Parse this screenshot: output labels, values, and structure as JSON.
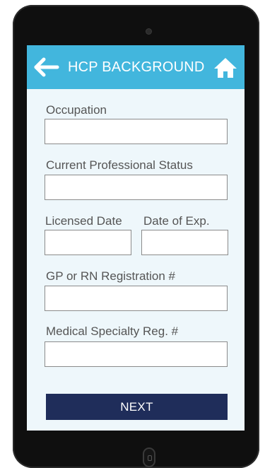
{
  "appbar": {
    "title": "HCP BACKGROUND",
    "back_icon": "arrow-left-icon",
    "home_icon": "home-icon",
    "color": "#42b6dd"
  },
  "form": {
    "occupation": {
      "label": "Occupation",
      "value": ""
    },
    "professional_status": {
      "label": "Current Professional Status",
      "value": ""
    },
    "licensed_date": {
      "label": "Licensed Date",
      "value": ""
    },
    "expiry_date": {
      "label": "Date of Exp.",
      "value": ""
    },
    "registration": {
      "label": "GP or RN Registration #",
      "value": ""
    },
    "specialty_reg": {
      "label": "Medical Specialty Reg. #",
      "value": ""
    }
  },
  "actions": {
    "next_label": "NEXT",
    "next_color": "#1f2d5a"
  }
}
